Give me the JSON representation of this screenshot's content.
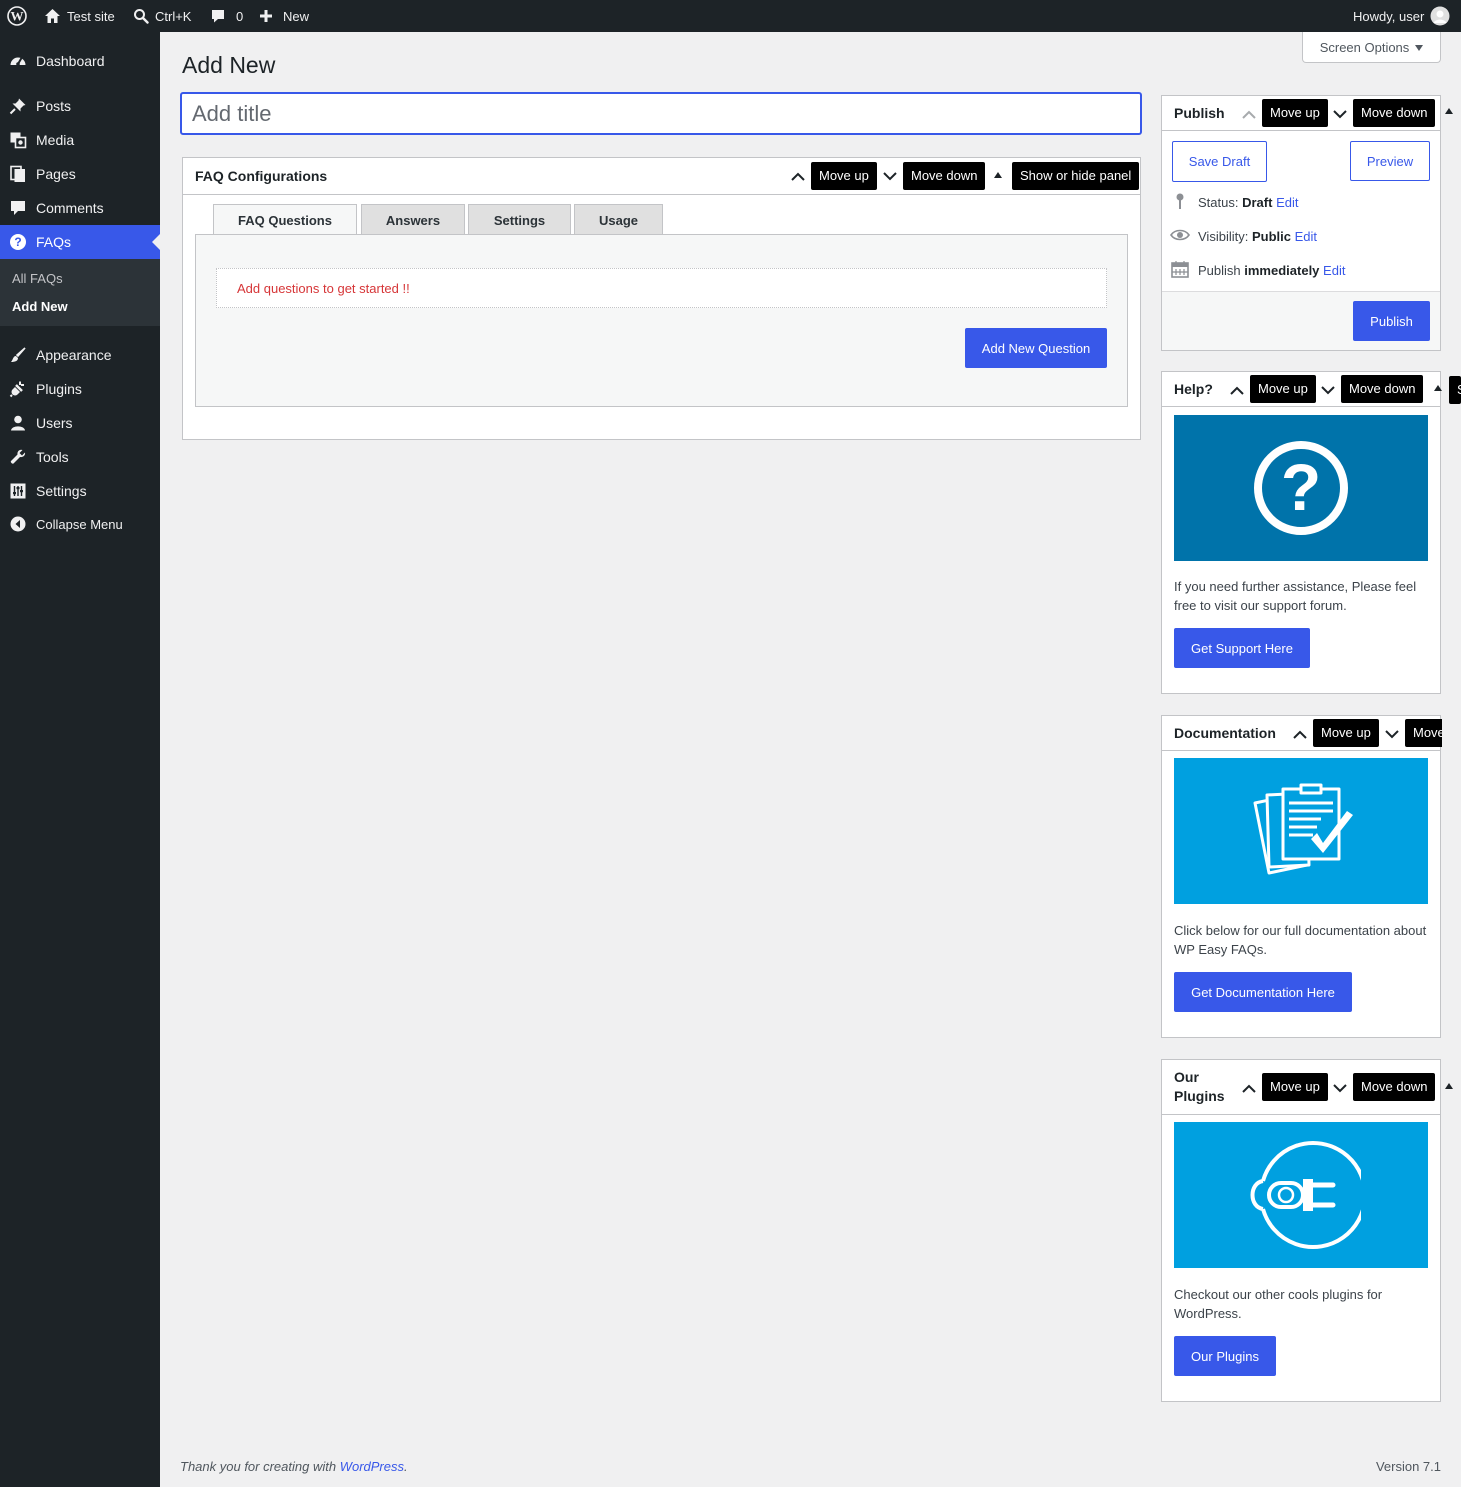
{
  "adminbar": {
    "site_name": "Test site",
    "search_shortcut": "Ctrl+K",
    "comments_count": "0",
    "new_label": "New",
    "greeting": "Howdy, user"
  },
  "sidebar": {
    "items": [
      {
        "label": "Dashboard",
        "icon": "dashboard-icon"
      },
      {
        "label": "Posts",
        "icon": "pin-icon"
      },
      {
        "label": "Media",
        "icon": "media-icon"
      },
      {
        "label": "Pages",
        "icon": "pages-icon"
      },
      {
        "label": "Comments",
        "icon": "comment-icon"
      },
      {
        "label": "FAQs",
        "icon": "question-icon"
      },
      {
        "label": "Appearance",
        "icon": "brush-icon"
      },
      {
        "label": "Plugins",
        "icon": "plug-icon"
      },
      {
        "label": "Users",
        "icon": "user-icon"
      },
      {
        "label": "Tools",
        "icon": "wrench-icon"
      },
      {
        "label": "Settings",
        "icon": "sliders-icon"
      },
      {
        "label": "Collapse Menu",
        "icon": "collapse-icon"
      }
    ],
    "submenu": [
      "All FAQs",
      "Add New"
    ],
    "accent_color": "#3858e9"
  },
  "screen_options": "Screen Options",
  "page_title": "Add New",
  "title_placeholder": "Add title",
  "handle": {
    "move_up": "Move up",
    "move_down": "Move down",
    "toggle": "Show or hide panel",
    "cut_move_down": "Move do",
    "cut_toggle": "S"
  },
  "faq_box": {
    "title": "FAQ Configurations",
    "tabs": [
      "FAQ Questions",
      "Answers",
      "Settings",
      "Usage"
    ],
    "notice": "Add questions to get started !!",
    "add_button": "Add New Question"
  },
  "publish": {
    "title": "Publish",
    "save_draft": "Save Draft",
    "preview": "Preview",
    "status_label": "Status:",
    "status_value": "Draft",
    "visibility_label": "Visibility:",
    "visibility_value": "Public",
    "schedule_label": "Publish",
    "schedule_value": "immediately",
    "edit": "Edit",
    "publish_button": "Publish"
  },
  "help_box": {
    "title": "Help?",
    "text": "If you need further assistance, Please feel free to visit our support forum.",
    "button": "Get Support Here",
    "image_color": "#0073aa"
  },
  "doc_box": {
    "title": "Documentation",
    "text": "Click below for our full documentation about WP Easy FAQs.",
    "button": "Get Documentation Here",
    "image_color": "#00a0e0"
  },
  "plugins_box": {
    "title_line1": "Our",
    "title_line2": "Plugins",
    "text": "Checkout our other cools plugins for WordPress.",
    "button": "Our Plugins",
    "image_color": "#00a0e0"
  },
  "footer": {
    "thanks_prefix": "Thank you for creating with",
    "wordpress_link": "WordPress",
    "thanks_suffix": ".",
    "version": "Version 7.1"
  }
}
